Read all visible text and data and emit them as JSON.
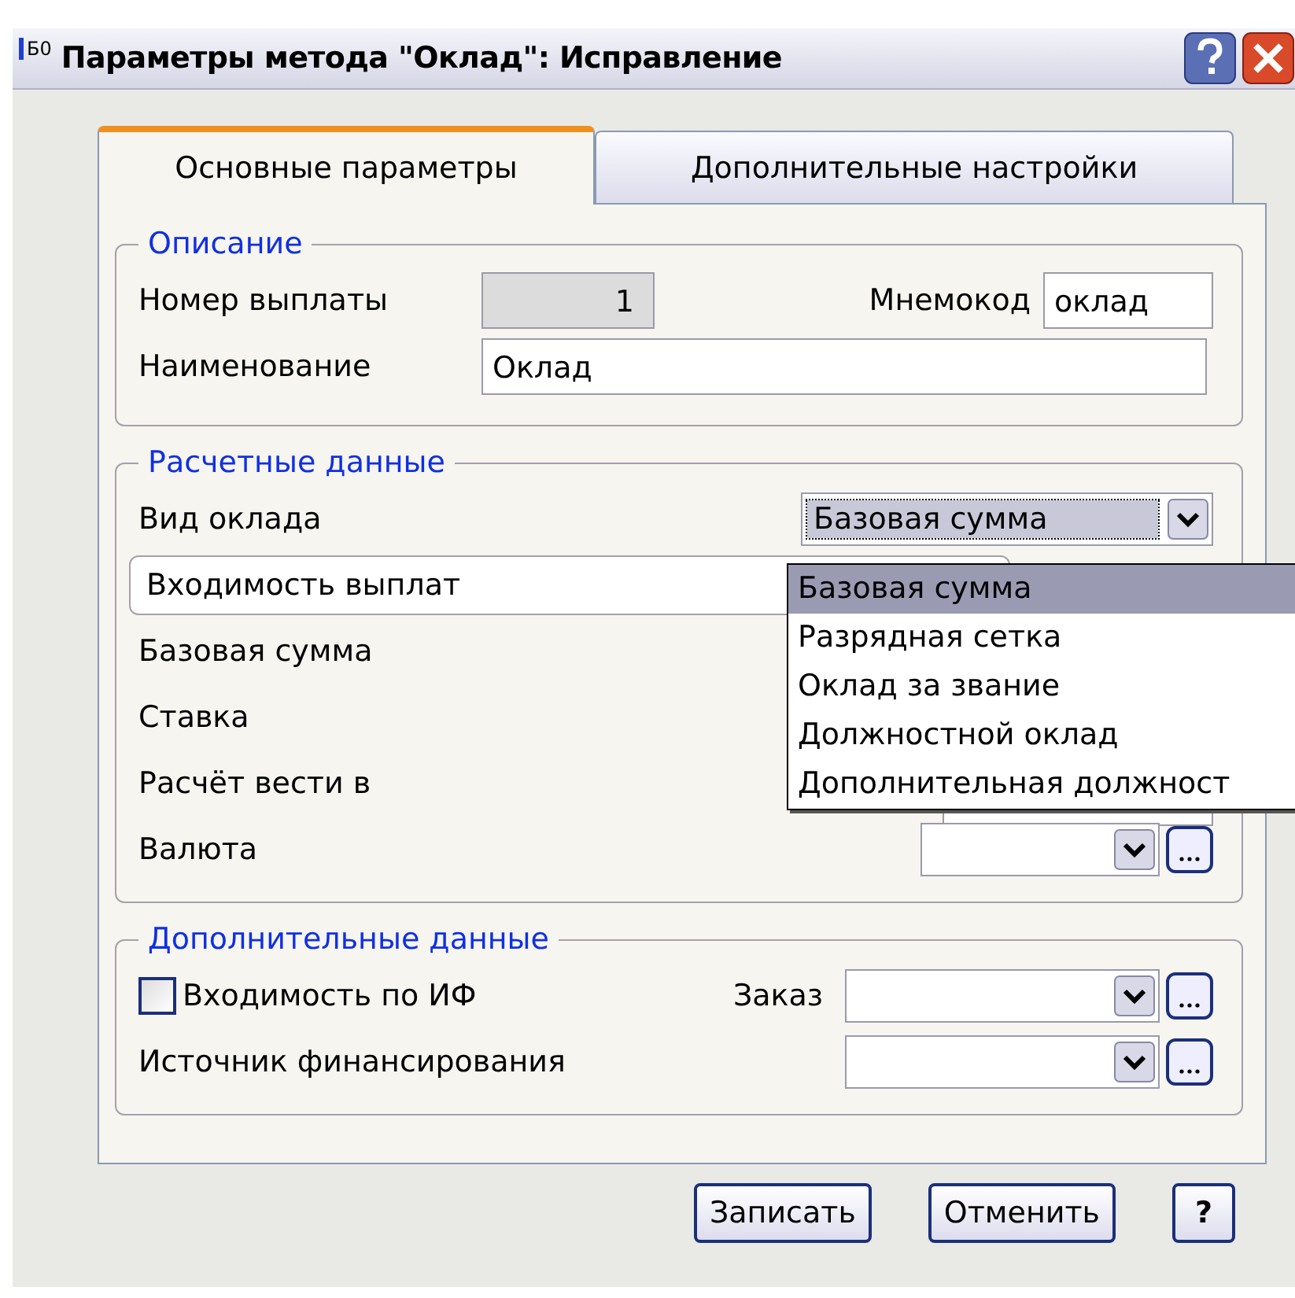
{
  "window": {
    "title": "Параметры метода \"Оклад\": Исправление",
    "icon_text": "Б0"
  },
  "tabs": [
    {
      "label": "Основные параметры",
      "selected": true
    },
    {
      "label": "Дополнительные настройки",
      "selected": false
    }
  ],
  "description": {
    "title": "Описание",
    "number_label": "Номер выплаты",
    "number_value": "1",
    "mnemo_label": "Мнемокод",
    "mnemo_value": "оклад",
    "name_label": "Наименование",
    "name_value": "Оклад"
  },
  "calc": {
    "title": "Расчетные данные",
    "rows": [
      {
        "kind": "combo",
        "label": "Вид оклада",
        "value": "Базовая сумма"
      },
      {
        "kind": "wide-button",
        "label": "Входимость выплат"
      },
      {
        "kind": "label",
        "label": "Базовая сумма"
      },
      {
        "kind": "label",
        "label": "Ставка"
      },
      {
        "kind": "field",
        "label": "Расчёт вести в"
      },
      {
        "kind": "combo-dots",
        "label": "Валюта"
      }
    ],
    "dropdown": [
      {
        "label": "Базовая сумма",
        "selected": true
      },
      {
        "label": "Разрядная сетка",
        "selected": false
      },
      {
        "label": "Оклад за звание",
        "selected": false
      },
      {
        "label": "Должностной оклад",
        "selected": false
      },
      {
        "label": "Дополнительная должност",
        "selected": false
      }
    ]
  },
  "extra": {
    "title": "Дополнительные данные",
    "checkbox_label": "Входимость по ИФ",
    "checked": false,
    "order_label": "Заказ",
    "source_label": "Источник финансирования"
  },
  "buttons": [
    {
      "kind": "text",
      "label": "Записать"
    },
    {
      "kind": "text",
      "label": "Отменить"
    },
    {
      "kind": "help",
      "label": "?"
    }
  ]
}
